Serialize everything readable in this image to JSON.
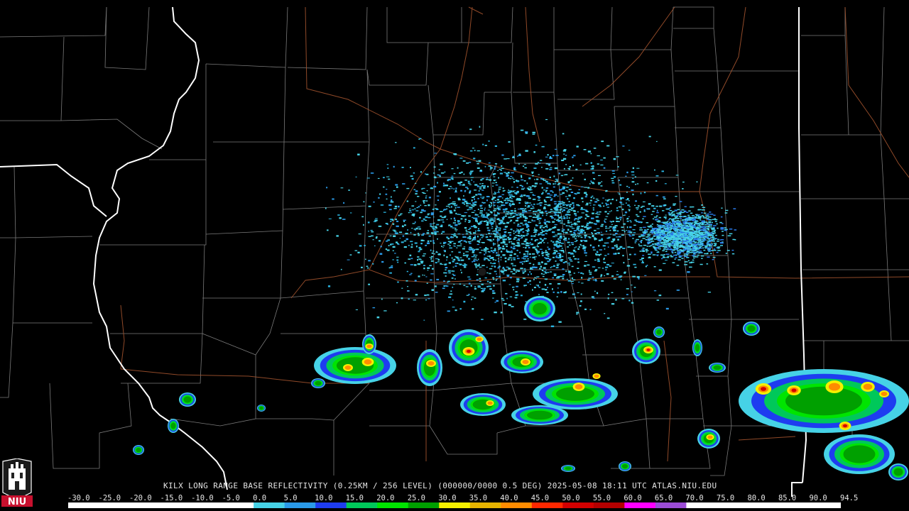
{
  "product": {
    "title_line": "KILX LONG RANGE BASE REFLECTIVITY (0.25KM / 256 LEVEL) (000000/0000 0.5 DEG) 2025-05-08 18:11 UTC  ATLAS.NIU.EDU"
  },
  "logo": {
    "text": "NIU"
  },
  "color_scale": {
    "labels": [
      "-30.0",
      "-25.0",
      "-20.0",
      "-15.0",
      "-10.0",
      "-5.0",
      "0.0",
      "5.0",
      "10.0",
      "15.0",
      "20.0",
      "25.0",
      "30.0",
      "35.0",
      "40.0",
      "45.0",
      "50.0",
      "55.0",
      "60.0",
      "65.0",
      "70.0",
      "75.0",
      "80.0",
      "85.0",
      "90.0",
      "94.5"
    ],
    "colors": [
      "#ffffff",
      "#ffffff",
      "#ffffff",
      "#ffffff",
      "#ffffff",
      "#ffffff",
      "#46d2e6",
      "#2a9ae8",
      "#1e3cf0",
      "#00c85a",
      "#00e400",
      "#00a000",
      "#f5f000",
      "#e6b400",
      "#ff8c00",
      "#ff2800",
      "#d20000",
      "#b40000",
      "#ff00ff",
      "#9b4cd6",
      "#ffffff",
      "#ffffff",
      "#ffffff",
      "#ffffff",
      "#ffffff"
    ]
  },
  "map_colors": {
    "background": "#000000",
    "county": "#8a8a8a",
    "state": "#ffffff",
    "road": "#a0522d",
    "radar_site": "#1a1a1a"
  }
}
